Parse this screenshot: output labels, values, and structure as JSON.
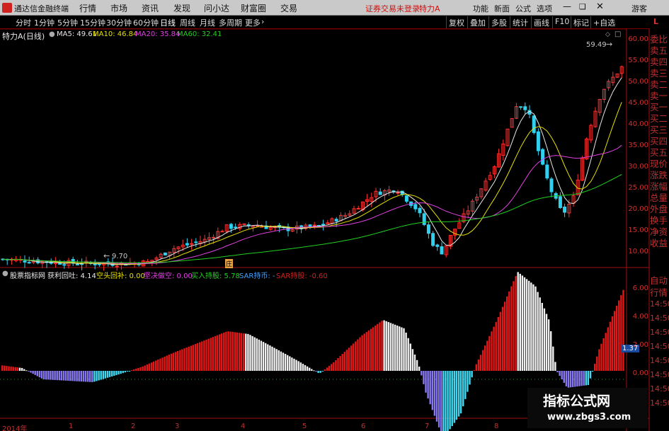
{
  "app": {
    "title": "通达信金融终端",
    "menu": [
      "行情",
      "市场",
      "资讯",
      "发现",
      "问小达",
      "财富圈",
      "交易"
    ],
    "notice": "证券交易未登录",
    "stock_tag": "特力A",
    "right_menu": [
      "功能",
      "新面",
      "公式",
      "选项"
    ],
    "guest": "游客"
  },
  "toolbar": {
    "periods": [
      "分时",
      "1分钟",
      "5分钟",
      "15分钟",
      "30分钟",
      "60分钟",
      "日线",
      "周线",
      "月线",
      "多周期",
      "更多"
    ],
    "active_period": "日线",
    "actions": [
      "复权",
      "叠加",
      "多股",
      "统计",
      "画线",
      "F10",
      "标记",
      "+自选"
    ]
  },
  "chart": {
    "stock_label": "特力A(日线)",
    "ma": [
      {
        "label": "MA5: 49.61",
        "color": "#e8e8e8"
      },
      {
        "label": "MA10: 46.84",
        "color": "#e8e000"
      },
      {
        "label": "MA20: 35.84",
        "color": "#e040e0"
      },
      {
        "label": "MA60: 32.41",
        "color": "#20d020"
      }
    ],
    "y_ticks": [
      "60.00",
      "55.00",
      "50.00",
      "45.00",
      "40.00",
      "35.00",
      "30.00",
      "25.00",
      "20.00",
      "15.00",
      "10.00"
    ],
    "low_annot": "9.70",
    "high_annot": "59.49",
    "badge": "庄"
  },
  "indicator": {
    "name": "股票指标网",
    "items": [
      {
        "label": "获利回吐: 4.14",
        "color": "#e8e8e8"
      },
      {
        "label": "空头回补: 0.00",
        "color": "#e8e000"
      },
      {
        "label": "坚决做空: 0.00",
        "color": "#e040e0"
      },
      {
        "label": "买入持股: 5.78",
        "color": "#20d020"
      },
      {
        "label": "SAR持币: -",
        "color": "#40a0ff"
      },
      {
        "label": "SAR持股: -0.60",
        "color": "#d02020"
      }
    ],
    "y_ticks": [
      "6.00",
      "4.00",
      "2.00",
      "0.00"
    ],
    "current": "1.37"
  },
  "xaxis": {
    "labels": [
      "2014年",
      "1",
      "2",
      "3",
      "4",
      "5",
      "6",
      "7",
      "8"
    ]
  },
  "sidebar": {
    "items": [
      "委比",
      "卖五",
      "卖四",
      "卖三",
      "卖二",
      "卖一",
      "买一",
      "买二",
      "买三",
      "买四",
      "买五",
      "现价",
      "涨跌",
      "涨幅",
      "总量",
      "外盘",
      "换手",
      "净资",
      "收益"
    ],
    "lower": [
      "自动",
      "行情"
    ],
    "times": [
      "14:50",
      "14:50",
      "14:50",
      "14:50",
      "14:50",
      "14:50",
      "14:50",
      "14:50"
    ],
    "top_letter": "L"
  },
  "watermark": {
    "line1": "指标公式网",
    "line2": "www.zbgs3.com"
  }
}
